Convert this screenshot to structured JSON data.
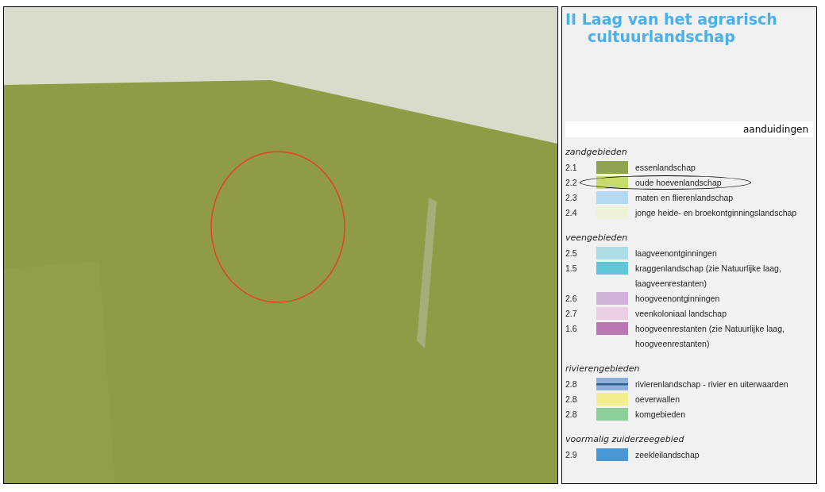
{
  "legend": {
    "title": "II Laag van het agrarisch cultuurlandschap",
    "header": "aanduidingen",
    "sections": [
      {
        "heading": "zandgebieden",
        "items": [
          {
            "code": "2.1",
            "label": "essenlandschap",
            "color": "#8fa34e",
            "kind": "fill",
            "highlighted": false
          },
          {
            "code": "2.2",
            "label": "oude hoevenlandschap",
            "color": "#c5dc6a",
            "kind": "fill",
            "highlighted": true
          },
          {
            "code": "2.3",
            "label": "maten en flierenlandschap",
            "color": "#b5d9f3",
            "kind": "fill",
            "highlighted": false
          },
          {
            "code": "2.4",
            "label": "jonge heide- en broekontginningslandschap",
            "color": "#eef2d8",
            "kind": "fill",
            "highlighted": false
          }
        ]
      },
      {
        "heading": "veengebieden",
        "items": [
          {
            "code": "2.5",
            "label": "laagveenontginningen",
            "color": "#acdce6",
            "kind": "fill",
            "highlighted": false
          },
          {
            "code": "1.5",
            "label": "kraggenlandschap  (zie Natuurlijke laag, laagveenrestanten)",
            "color": "#5fc6d8",
            "kind": "fill",
            "highlighted": false
          },
          {
            "code": "2.6",
            "label": "hoogveenontginningen",
            "color": "#d1b3d9",
            "kind": "fill",
            "highlighted": false
          },
          {
            "code": "2.7",
            "label": "veenkoloniaal landschap",
            "color": "#ebcde6",
            "kind": "fill",
            "highlighted": false
          },
          {
            "code": "1.6",
            "label": "hoogveenrestanten (zie Natuurlijke laag, hoogveenrestanten)",
            "color": "#b877b3",
            "kind": "fill",
            "highlighted": false
          }
        ]
      },
      {
        "heading": "rivierengebieden",
        "items": [
          {
            "code": "2.8",
            "label": "rivierenlandschap - rivier en uiterwaarden",
            "color": "#8eb0d8",
            "kind": "line",
            "highlighted": false
          },
          {
            "code": "2.8",
            "label": "oeverwallen",
            "color": "#f0ee8e",
            "kind": "fill",
            "highlighted": false
          },
          {
            "code": "2.8",
            "label": "komgebieden",
            "color": "#8ccf98",
            "kind": "fill",
            "highlighted": false
          }
        ]
      },
      {
        "heading": "voormalig zuiderzeegebied",
        "items": [
          {
            "code": "2.9",
            "label": "zeekleilandschap",
            "color": "#4a97d2",
            "kind": "fill",
            "highlighted": false
          }
        ]
      }
    ]
  }
}
